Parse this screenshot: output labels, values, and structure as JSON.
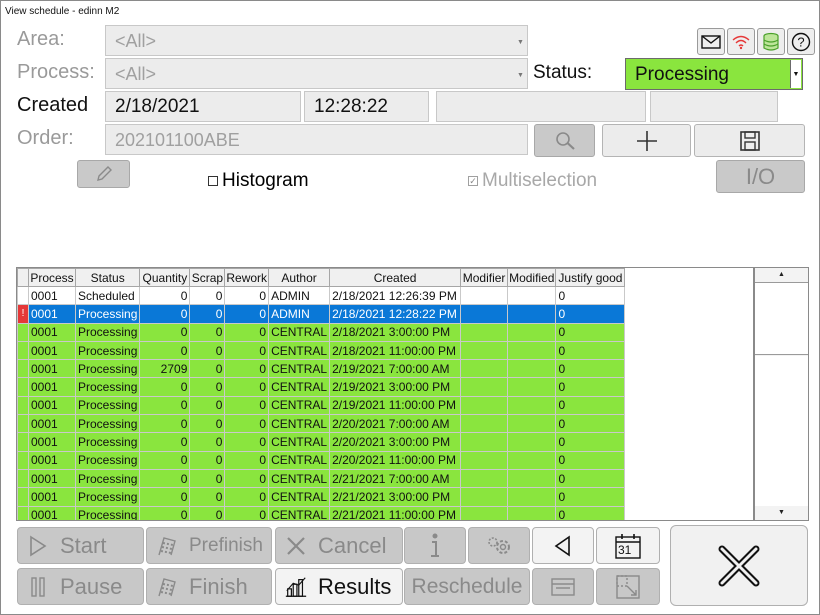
{
  "window": {
    "title": "View schedule - edinn M2"
  },
  "form": {
    "area_label": "Area:",
    "area_value": "<All>",
    "process_label": "Process:",
    "process_value": "<All>",
    "status_label": "Status:",
    "status_value": "Processing",
    "created_label": "Created",
    "created_date": "2/18/2021",
    "created_time": "12:28:22",
    "order_label": "Order:",
    "order_value": "202101100ABE",
    "histogram_label": "Histogram",
    "multiselection_label": "Multiselection",
    "io_label": "I/O",
    "colors": {
      "status_green": "#8ae53e",
      "selected_blue": "#0a78d7"
    }
  },
  "toolbar_icons": [
    "mail-icon",
    "wifi-icon",
    "database-icon",
    "help-icon"
  ],
  "table": {
    "columns": [
      "Process",
      "Status",
      "Quantity",
      "Scrap",
      "Rework",
      "Author",
      "Created",
      "Modifier",
      "Modified",
      "Justify good"
    ],
    "rows": [
      {
        "process": "0001",
        "status": "Scheduled",
        "quantity": "0",
        "scrap": "0",
        "rework": "0",
        "author": "ADMIN",
        "created": "2/18/2021 12:26:39 PM",
        "modifier": "",
        "modified": "",
        "justify": "0",
        "ind": ""
      },
      {
        "process": "0001",
        "status": "Processing",
        "quantity": "0",
        "scrap": "0",
        "rework": "0",
        "author": "ADMIN",
        "created": "2/18/2021 12:28:22 PM",
        "modifier": "",
        "modified": "",
        "justify": "0",
        "ind": "!"
      },
      {
        "process": "0001",
        "status": "Processing",
        "quantity": "0",
        "scrap": "0",
        "rework": "0",
        "author": "CENTRAL",
        "created": "2/18/2021 3:00:00 PM",
        "modifier": "",
        "modified": "",
        "justify": "0",
        "ind": ""
      },
      {
        "process": "0001",
        "status": "Processing",
        "quantity": "0",
        "scrap": "0",
        "rework": "0",
        "author": "CENTRAL",
        "created": "2/18/2021 11:00:00 PM",
        "modifier": "",
        "modified": "",
        "justify": "0",
        "ind": ""
      },
      {
        "process": "0001",
        "status": "Processing",
        "quantity": "2709",
        "scrap": "0",
        "rework": "0",
        "author": "CENTRAL",
        "created": "2/19/2021 7:00:00 AM",
        "modifier": "",
        "modified": "",
        "justify": "0",
        "ind": ""
      },
      {
        "process": "0001",
        "status": "Processing",
        "quantity": "0",
        "scrap": "0",
        "rework": "0",
        "author": "CENTRAL",
        "created": "2/19/2021 3:00:00 PM",
        "modifier": "",
        "modified": "",
        "justify": "0",
        "ind": ""
      },
      {
        "process": "0001",
        "status": "Processing",
        "quantity": "0",
        "scrap": "0",
        "rework": "0",
        "author": "CENTRAL",
        "created": "2/19/2021 11:00:00 PM",
        "modifier": "",
        "modified": "",
        "justify": "0",
        "ind": ""
      },
      {
        "process": "0001",
        "status": "Processing",
        "quantity": "0",
        "scrap": "0",
        "rework": "0",
        "author": "CENTRAL",
        "created": "2/20/2021 7:00:00 AM",
        "modifier": "",
        "modified": "",
        "justify": "0",
        "ind": ""
      },
      {
        "process": "0001",
        "status": "Processing",
        "quantity": "0",
        "scrap": "0",
        "rework": "0",
        "author": "CENTRAL",
        "created": "2/20/2021 3:00:00 PM",
        "modifier": "",
        "modified": "",
        "justify": "0",
        "ind": ""
      },
      {
        "process": "0001",
        "status": "Processing",
        "quantity": "0",
        "scrap": "0",
        "rework": "0",
        "author": "CENTRAL",
        "created": "2/20/2021 11:00:00 PM",
        "modifier": "",
        "modified": "",
        "justify": "0",
        "ind": ""
      },
      {
        "process": "0001",
        "status": "Processing",
        "quantity": "0",
        "scrap": "0",
        "rework": "0",
        "author": "CENTRAL",
        "created": "2/21/2021 7:00:00 AM",
        "modifier": "",
        "modified": "",
        "justify": "0",
        "ind": ""
      },
      {
        "process": "0001",
        "status": "Processing",
        "quantity": "0",
        "scrap": "0",
        "rework": "0",
        "author": "CENTRAL",
        "created": "2/21/2021 3:00:00 PM",
        "modifier": "",
        "modified": "",
        "justify": "0",
        "ind": ""
      },
      {
        "process": "0001",
        "status": "Processing",
        "quantity": "0",
        "scrap": "0",
        "rework": "0",
        "author": "CENTRAL",
        "created": "2/21/2021 11:00:00 PM",
        "modifier": "",
        "modified": "",
        "justify": "0",
        "ind": ""
      }
    ]
  },
  "actions": {
    "start": "Start",
    "prefinish": "Prefinish",
    "cancel": "Cancel",
    "pause": "Pause",
    "finish": "Finish",
    "results": "Results",
    "reschedule": "Reschedule",
    "calendar_day": "31"
  }
}
